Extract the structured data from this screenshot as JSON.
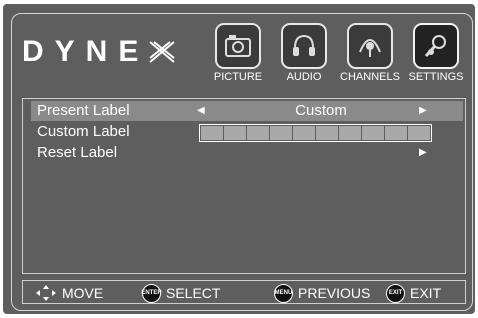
{
  "brand": {
    "logo_text": "DYNE"
  },
  "tabs": [
    {
      "id": "picture",
      "label": "PICTURE",
      "icon": "picture-icon",
      "selected": false
    },
    {
      "id": "audio",
      "label": "AUDIO",
      "icon": "audio-icon",
      "selected": false
    },
    {
      "id": "channels",
      "label": "CHANNELS",
      "icon": "channels-icon",
      "selected": false
    },
    {
      "id": "settings",
      "label": "SETTINGS",
      "icon": "settings-icon",
      "selected": true
    }
  ],
  "menu": {
    "present_label": {
      "label": "Present Label",
      "value": "Custom"
    },
    "custom_label": {
      "label": "Custom Label",
      "cells": 10
    },
    "reset_label": {
      "label": "Reset Label"
    }
  },
  "footer": {
    "move": "MOVE",
    "enter_badge": "ENTER",
    "select": "SELECT",
    "menu_badge": "MENU",
    "previous": "PREVIOUS",
    "exit_badge": "EXIT",
    "exit": "EXIT"
  },
  "colors": {
    "background": "#5e5e5e",
    "highlight": "#8a8a8a",
    "input_cell": "#a9a9a9"
  }
}
